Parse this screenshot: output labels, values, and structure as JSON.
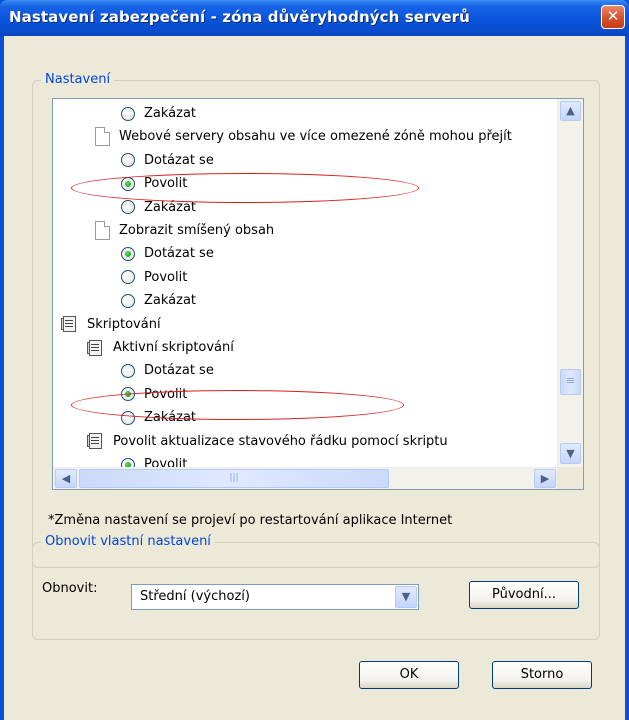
{
  "window": {
    "title": "Nastavení zabezpečení - zóna důvěryhodných serverů",
    "close_glyph": "✕"
  },
  "settings_group": {
    "label": "Nastavení",
    "tree": [
      {
        "kind": "radio",
        "label": "Zakázat",
        "checked": false
      },
      {
        "kind": "doc",
        "label": "Webové servery obsahu ve více omezené zóně mohou přejít"
      },
      {
        "kind": "radio",
        "label": "Dotázat se",
        "checked": false
      },
      {
        "kind": "radio",
        "label": "Povolit",
        "checked": true
      },
      {
        "kind": "radio",
        "label": "Zakázat",
        "checked": false
      },
      {
        "kind": "doc",
        "label": "Zobrazit smíšený obsah"
      },
      {
        "kind": "radio",
        "label": "Dotázat se",
        "checked": true
      },
      {
        "kind": "radio",
        "label": "Povolit",
        "checked": false
      },
      {
        "kind": "radio",
        "label": "Zakázat",
        "checked": false
      },
      {
        "kind": "script",
        "label": "Skriptování"
      },
      {
        "kind": "script",
        "label": "Aktivní skriptování"
      },
      {
        "kind": "radio",
        "label": "Dotázat se",
        "checked": false
      },
      {
        "kind": "radio",
        "label": "Povolit",
        "checked": true
      },
      {
        "kind": "radio",
        "label": "Zakázat",
        "checked": false
      },
      {
        "kind": "script",
        "label": "Povolit aktualizace stavového řádku pomocí skriptu"
      },
      {
        "kind": "radio",
        "label": "Povolit",
        "checked": true
      }
    ],
    "scroll_glyphs": {
      "up": "▲",
      "down": "▼",
      "left": "◀",
      "right": "▶",
      "grip": "≡",
      "hgrip": "|||"
    },
    "note": "*Změna nastavení se projeví po restartování aplikace Internet"
  },
  "reset_group": {
    "label": "Obnovit vlastní nastavení",
    "reset_label": "Obnovit:",
    "reset_value": "Střední (výchozí)",
    "dropdown_glyph": "▼",
    "reset_button": "Původní..."
  },
  "buttons": {
    "ok": "OK",
    "cancel": "Storno"
  },
  "colors": {
    "titlebar": "#0a54dc",
    "dialog_bg": "#ece9d8",
    "group_label": "#0046d5",
    "annotation": "#d62020"
  }
}
